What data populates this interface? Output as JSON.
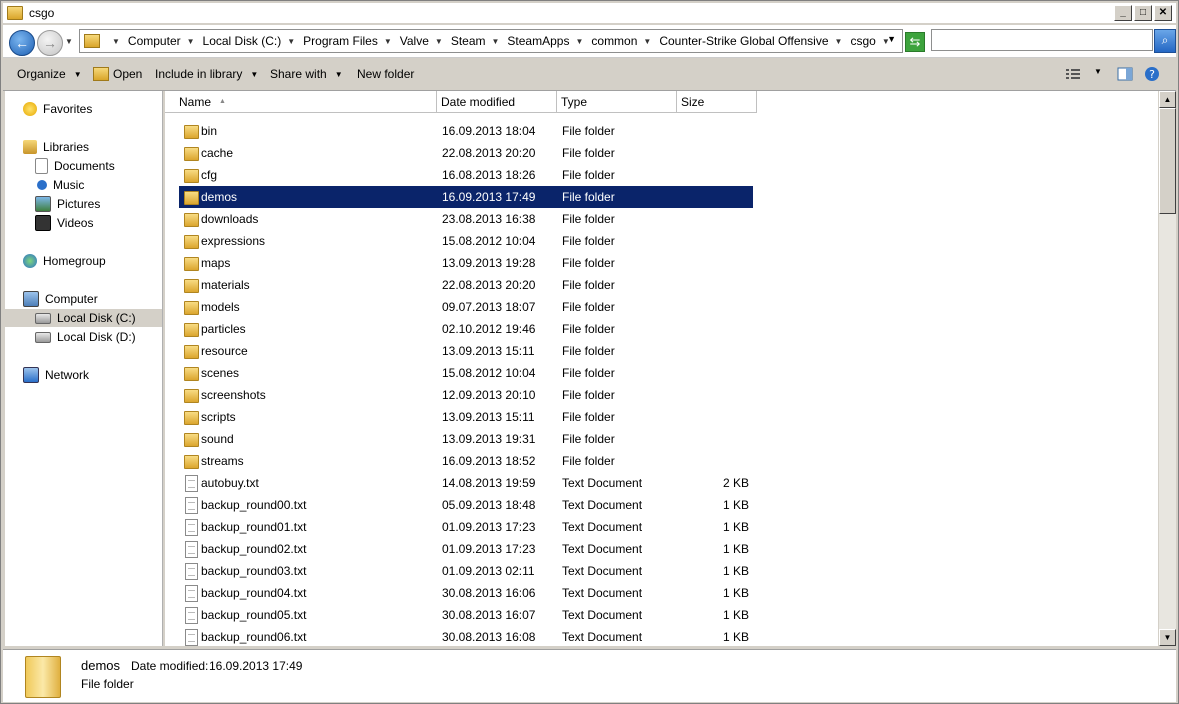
{
  "window": {
    "title": "csgo",
    "min": "_",
    "max": "□",
    "close": "✕"
  },
  "address": {
    "crumbs": [
      "Computer",
      "Local Disk (C:)",
      "Program Files",
      "Valve",
      "Steam",
      "SteamApps",
      "common",
      "Counter-Strike Global Offensive",
      "csgo"
    ],
    "search_value": ""
  },
  "toolbar": {
    "organize": "Organize",
    "open": "Open",
    "include": "Include in library",
    "share": "Share with",
    "newfolder": "New folder"
  },
  "nav": {
    "favorites": "Favorites",
    "libraries": "Libraries",
    "documents": "Documents",
    "music": "Music",
    "pictures": "Pictures",
    "videos": "Videos",
    "homegroup": "Homegroup",
    "computer": "Computer",
    "localc": "Local Disk (C:)",
    "locald": "Local Disk (D:)",
    "network": "Network"
  },
  "columns": {
    "name": "Name",
    "date": "Date modified",
    "type": "Type",
    "size": "Size"
  },
  "files": [
    {
      "name": "bin",
      "date": "16.09.2013 18:04",
      "type": "File folder",
      "size": "",
      "kind": "folder"
    },
    {
      "name": "cache",
      "date": "22.08.2013 20:20",
      "type": "File folder",
      "size": "",
      "kind": "folder"
    },
    {
      "name": "cfg",
      "date": "16.08.2013 18:26",
      "type": "File folder",
      "size": "",
      "kind": "folder"
    },
    {
      "name": "demos",
      "date": "16.09.2013 17:49",
      "type": "File folder",
      "size": "",
      "kind": "folder",
      "selected": true
    },
    {
      "name": "downloads",
      "date": "23.08.2013 16:38",
      "type": "File folder",
      "size": "",
      "kind": "folder"
    },
    {
      "name": "expressions",
      "date": "15.08.2012 10:04",
      "type": "File folder",
      "size": "",
      "kind": "folder"
    },
    {
      "name": "maps",
      "date": "13.09.2013 19:28",
      "type": "File folder",
      "size": "",
      "kind": "folder"
    },
    {
      "name": "materials",
      "date": "22.08.2013 20:20",
      "type": "File folder",
      "size": "",
      "kind": "folder"
    },
    {
      "name": "models",
      "date": "09.07.2013 18:07",
      "type": "File folder",
      "size": "",
      "kind": "folder"
    },
    {
      "name": "particles",
      "date": "02.10.2012 19:46",
      "type": "File folder",
      "size": "",
      "kind": "folder"
    },
    {
      "name": "resource",
      "date": "13.09.2013 15:11",
      "type": "File folder",
      "size": "",
      "kind": "folder"
    },
    {
      "name": "scenes",
      "date": "15.08.2012 10:04",
      "type": "File folder",
      "size": "",
      "kind": "folder"
    },
    {
      "name": "screenshots",
      "date": "12.09.2013 20:10",
      "type": "File folder",
      "size": "",
      "kind": "folder"
    },
    {
      "name": "scripts",
      "date": "13.09.2013 15:11",
      "type": "File folder",
      "size": "",
      "kind": "folder"
    },
    {
      "name": "sound",
      "date": "13.09.2013 19:31",
      "type": "File folder",
      "size": "",
      "kind": "folder"
    },
    {
      "name": "streams",
      "date": "16.09.2013 18:52",
      "type": "File folder",
      "size": "",
      "kind": "folder"
    },
    {
      "name": "autobuy.txt",
      "date": "14.08.2013 19:59",
      "type": "Text Document",
      "size": "2 KB",
      "kind": "doc"
    },
    {
      "name": "backup_round00.txt",
      "date": "05.09.2013 18:48",
      "type": "Text Document",
      "size": "1 KB",
      "kind": "doc"
    },
    {
      "name": "backup_round01.txt",
      "date": "01.09.2013 17:23",
      "type": "Text Document",
      "size": "1 KB",
      "kind": "doc"
    },
    {
      "name": "backup_round02.txt",
      "date": "01.09.2013 17:23",
      "type": "Text Document",
      "size": "1 KB",
      "kind": "doc"
    },
    {
      "name": "backup_round03.txt",
      "date": "01.09.2013 02:11",
      "type": "Text Document",
      "size": "1 KB",
      "kind": "doc"
    },
    {
      "name": "backup_round04.txt",
      "date": "30.08.2013 16:06",
      "type": "Text Document",
      "size": "1 KB",
      "kind": "doc"
    },
    {
      "name": "backup_round05.txt",
      "date": "30.08.2013 16:07",
      "type": "Text Document",
      "size": "1 KB",
      "kind": "doc"
    },
    {
      "name": "backup_round06.txt",
      "date": "30.08.2013 16:08",
      "type": "Text Document",
      "size": "1 KB",
      "kind": "doc"
    }
  ],
  "details": {
    "name": "demos",
    "date_label": "Date modified:",
    "date_value": "16.09.2013 17:49",
    "type": "File folder"
  },
  "colors": {
    "selection": "#0a246a",
    "chrome": "#d4d0c8"
  },
  "icons": {
    "up": "▲",
    "down": "▼",
    "search": "⌕",
    "refresh": "⇆",
    "help": "?"
  }
}
